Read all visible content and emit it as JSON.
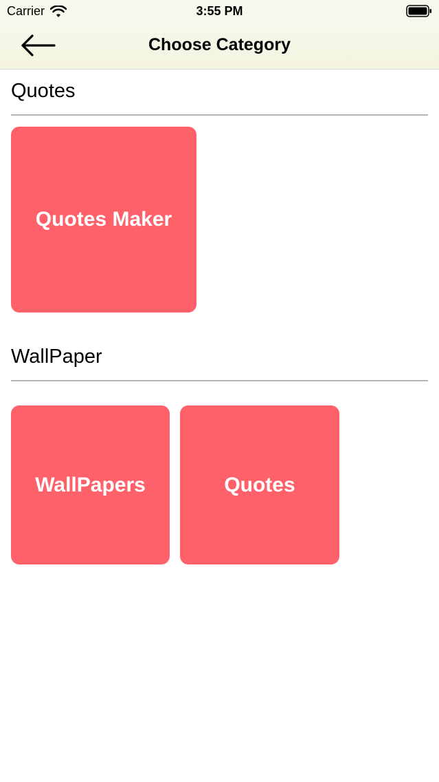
{
  "status_bar": {
    "carrier": "Carrier",
    "time": "3:55 PM"
  },
  "nav": {
    "title": "Choose Category",
    "back_icon": "arrow-left-icon"
  },
  "sections": [
    {
      "title": "Quotes",
      "tiles": [
        {
          "label": "Quotes Maker"
        }
      ]
    },
    {
      "title": "WallPaper",
      "tiles": [
        {
          "label": "WallPapers"
        },
        {
          "label": "Quotes"
        }
      ]
    }
  ],
  "colors": {
    "tile": "#ff616b",
    "nav_background": "#f7f8ec",
    "divider": "#b3b3b3"
  }
}
